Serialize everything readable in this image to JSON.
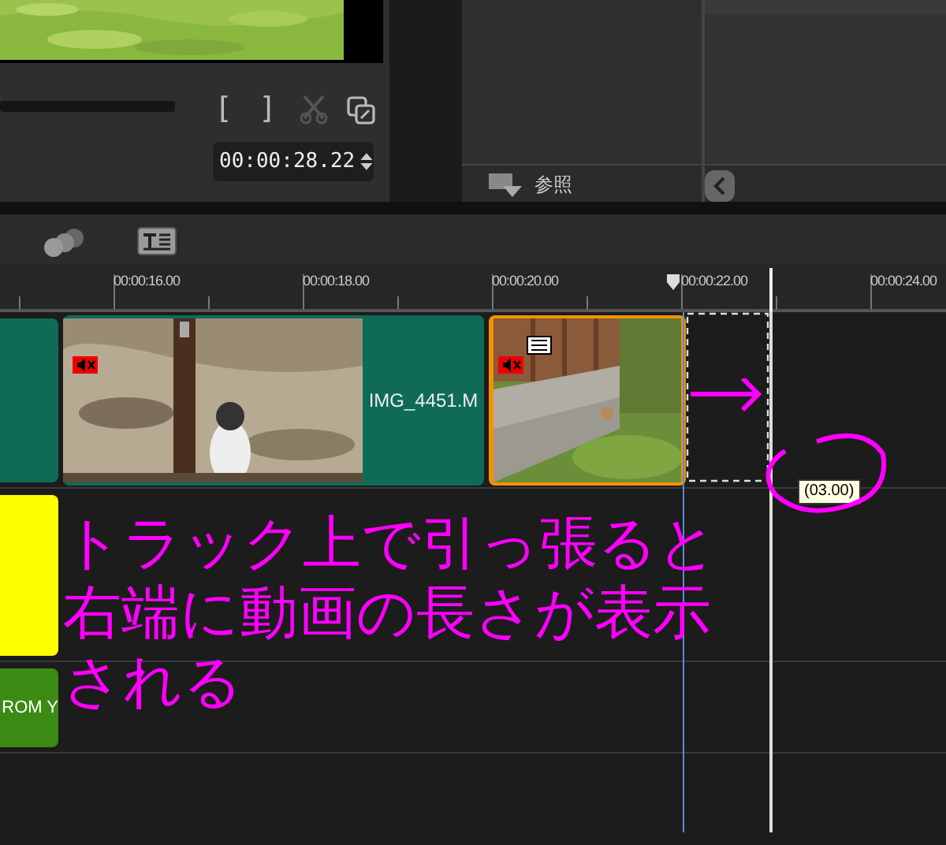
{
  "preview": {
    "controls": [
      {
        "kind": "mark_in",
        "label": "[",
        "disabled": false
      },
      {
        "kind": "mark_out",
        "label": "]",
        "disabled": false
      },
      {
        "kind": "cut",
        "disabled": true
      },
      {
        "kind": "copy",
        "disabled": false
      }
    ],
    "timecode": "00:00:28.22"
  },
  "browse_panel": {
    "button": "参照"
  },
  "ruler": {
    "labels": [
      "00:00:16.00",
      "00:00:18.00",
      "00:00:20.00",
      "00:00:22.00",
      "00:00:24.00"
    ]
  },
  "tracks": [
    {
      "clips": [
        {
          "kind": "color",
          "selected": false
        },
        {
          "kind": "video",
          "label": "IMG_4451.M",
          "muted": true,
          "selected": false
        },
        {
          "kind": "video",
          "muted": true,
          "title_icon": true,
          "selected": true
        }
      ]
    },
    {
      "clips": [
        {
          "kind": "yellow",
          "selected": false
        }
      ]
    },
    {
      "clips": [
        {
          "kind": "green",
          "label": "ROM Y",
          "selected": false
        }
      ]
    }
  ],
  "tooltip": "(03.00)",
  "annotation": {
    "lines": [
      "トラック上で引っ張ると",
      "右端に動画の長さが表示",
      "される"
    ]
  }
}
